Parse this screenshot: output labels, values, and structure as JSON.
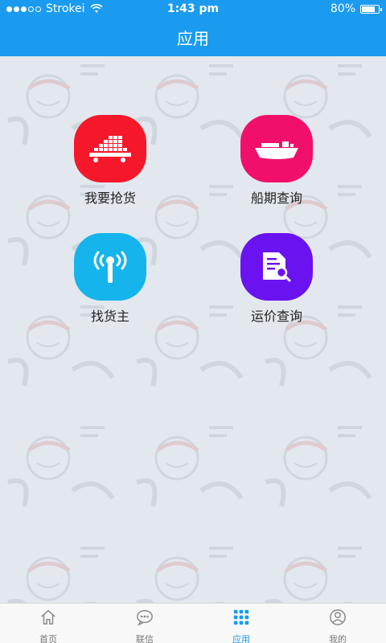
{
  "status_bar": {
    "carrier": "Strokei",
    "time": "1:43 pm",
    "battery_percent": "80%",
    "battery_level": 0.8
  },
  "header": {
    "title": "应用"
  },
  "apps": [
    {
      "label": "我要抢货",
      "color": "#f5182b",
      "icon": "containers-truck-icon"
    },
    {
      "label": "船期查询",
      "color": "#f0106b",
      "icon": "ship-icon"
    },
    {
      "label": "找货主",
      "color": "#16b4ec",
      "icon": "signal-tower-icon"
    },
    {
      "label": "运价查询",
      "color": "#6a12f0",
      "icon": "document-search-icon"
    }
  ],
  "tabbar": {
    "items": [
      {
        "label": "首页",
        "icon": "home-icon",
        "active": false
      },
      {
        "label": "联信",
        "icon": "chat-icon",
        "active": false
      },
      {
        "label": "应用",
        "icon": "grid-icon",
        "active": true
      },
      {
        "label": "我的",
        "icon": "profile-icon",
        "active": false
      }
    ],
    "active_color": "#1a9bf0"
  }
}
